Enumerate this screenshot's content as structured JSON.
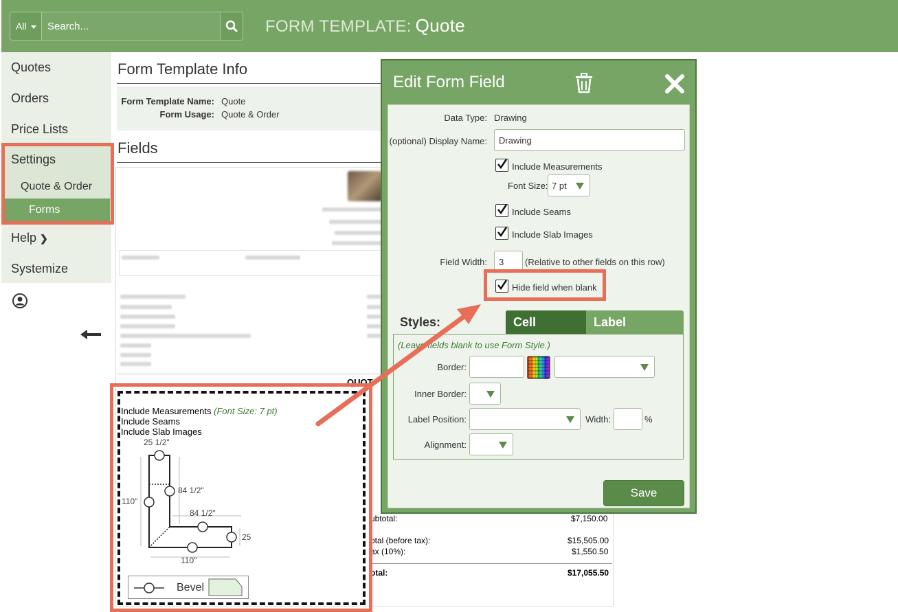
{
  "header": {
    "search_scope": "All",
    "search_placeholder": "Search...",
    "title_prefix": "FORM TEMPLATE:",
    "title_name": "Quote"
  },
  "sidebar": {
    "items": [
      "Quotes",
      "Orders",
      "Price Lists",
      "Settings"
    ],
    "settings_sub": [
      "Quote & Order",
      "Forms"
    ],
    "help": "Help",
    "systemize": "Systemize"
  },
  "main": {
    "info_title": "Form Template Info",
    "template_name_label": "Form Template Name:",
    "template_name_value": "Quote",
    "usage_label": "Form Usage:",
    "usage_value": "Quote & Order",
    "fields_title": "Fields"
  },
  "drawing": {
    "line1": "Include Measurements",
    "line1_note": "(Font Size: 7 pt)",
    "line2": "Include Seams",
    "line3": "Include Slab Images",
    "dims": [
      "25 1/2\"",
      "84 1/2\"",
      "110\"",
      "84 1/2\"",
      "25",
      "110\""
    ],
    "legend": "Bevel"
  },
  "totals": {
    "subtotal_label": "ubtotal:",
    "subtotal_value": "$7,150.00",
    "total_before_label": "otal (before tax):",
    "total_before_value": "$15,505.00",
    "tax_label": "ax (10%):",
    "tax_value": "$1,550.50",
    "total_label": "otal:",
    "total_value": "$17,055.50",
    "quote_partial": "QUOT"
  },
  "modal": {
    "title": "Edit Form Field",
    "data_type_label": "Data Type:",
    "data_type_value": "Drawing",
    "display_name_label": "(optional) Display Name:",
    "display_name_value": "Drawing",
    "include_measurements": "Include Measurements",
    "font_size_label": "Font Size:",
    "font_size_value": "7 pt",
    "include_seams": "Include Seams",
    "include_slab_images": "Include Slab Images",
    "field_width_label": "Field Width:",
    "field_width_value": "3",
    "field_width_note": "(Relative to other fields on this row)",
    "hide_when_blank": "Hide field when blank",
    "styles_label": "Styles:",
    "tab_cell": "Cell",
    "tab_label": "Label",
    "hint": "(Leave fields blank to use Form Style.)",
    "border_label": "Border:",
    "inner_border_label": "Inner Border:",
    "label_position_label": "Label Position:",
    "width_label": "Width:",
    "percent": "%",
    "alignment_label": "Alignment:",
    "save": "Save"
  },
  "colors": {
    "header_green": "#77a565",
    "highlight": "#e76e58",
    "active_tab": "#3f6f33"
  }
}
